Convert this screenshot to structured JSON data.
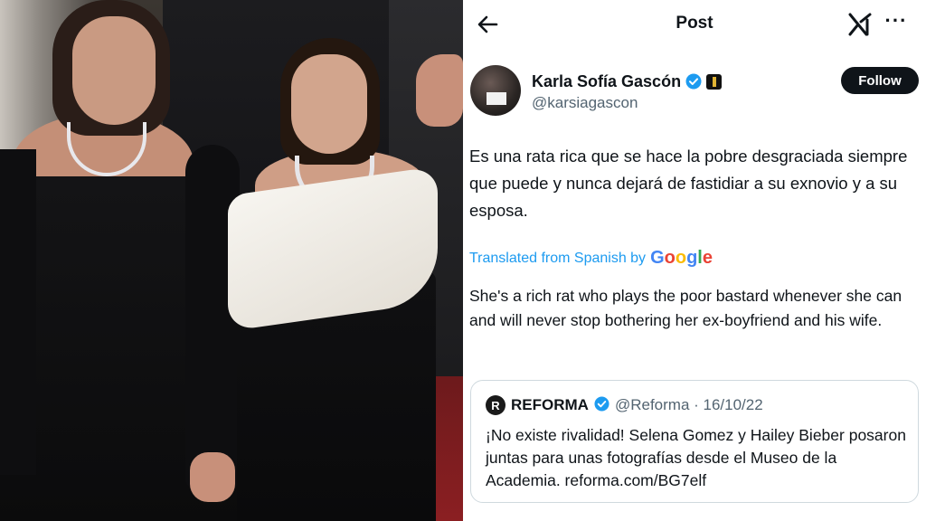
{
  "photo": {
    "description_icon": "photo-image"
  },
  "topbar": {
    "back_icon": "arrow-left-icon",
    "title": "Post",
    "logo_icon": "x-logo-icon",
    "more_label": "···"
  },
  "author": {
    "display_name": "Karla Sofía Gascón",
    "handle": "@karsiagascon",
    "verified_color": "#1d9bf0",
    "follow_label": "Follow"
  },
  "tweet": {
    "text": "Es una rata rica que se hace la pobre desgraciada siempre que puede y nunca dejará de fastidiar a su exnovio y a su esposa.",
    "translated_label": "Translated from Spanish by",
    "translator": "Google",
    "translation": "She's a rich rat who plays the poor bastard whenever she can and will never stop bothering her ex-boyfriend and his wife."
  },
  "quote": {
    "avatar_letter": "R",
    "name": "REFORMA",
    "handle_date": "@Reforma · 16/10/22",
    "text": "¡No existe rivalidad! Selena Gomez y Hailey Bieber posaron juntas para unas fotografías desde el Museo de la Academia.  reforma.com/BG7elf"
  },
  "colors": {
    "accent": "#1d9bf0",
    "text": "#0f1419",
    "secondary": "#536471",
    "border": "#cfd9de"
  }
}
